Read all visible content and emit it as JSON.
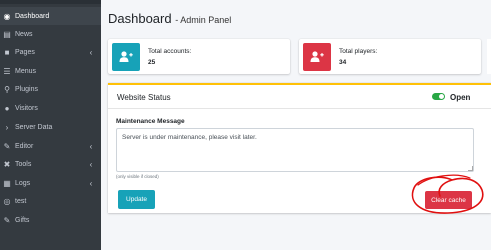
{
  "sidebar": {
    "items": [
      {
        "label": "Dashboard",
        "icon": "dashboard-icon",
        "glyph": "◉",
        "active": true,
        "has_children": false
      },
      {
        "label": "News",
        "icon": "newspaper-icon",
        "glyph": "▤",
        "active": false,
        "has_children": false
      },
      {
        "label": "Pages",
        "icon": "book-icon",
        "glyph": "■",
        "active": false,
        "has_children": true
      },
      {
        "label": "Menus",
        "icon": "menu-icon",
        "glyph": "☰",
        "active": false,
        "has_children": false
      },
      {
        "label": "Plugins",
        "icon": "plug-icon",
        "glyph": "⚲",
        "active": false,
        "has_children": false
      },
      {
        "label": "Visitors",
        "icon": "user-icon",
        "glyph": "●",
        "active": false,
        "has_children": false
      },
      {
        "label": "Server Data",
        "icon": "chevron-right-icon",
        "glyph": "›",
        "active": false,
        "has_children": false
      },
      {
        "label": "Editor",
        "icon": "edit-icon",
        "glyph": "✎",
        "active": false,
        "has_children": true
      },
      {
        "label": "Tools",
        "icon": "tools-icon",
        "glyph": "✖",
        "active": false,
        "has_children": true
      },
      {
        "label": "Logs",
        "icon": "logs-icon",
        "glyph": "▦",
        "active": false,
        "has_children": true
      },
      {
        "label": "test",
        "icon": "circle-icon",
        "glyph": "◎",
        "active": false,
        "has_children": false
      },
      {
        "label": "Gifts",
        "icon": "gift-icon",
        "glyph": "✎",
        "active": false,
        "has_children": false
      }
    ]
  },
  "header": {
    "title": "Dashboard",
    "subtitle": "- Admin Panel"
  },
  "stats": [
    {
      "label": "Total accounts:",
      "value": "25",
      "icon": "user-plus-icon",
      "color": "#17a2b8"
    },
    {
      "label": "Total players:",
      "value": "34",
      "icon": "user-plus-icon",
      "color": "#dc3545"
    }
  ],
  "website_status": {
    "title": "Website Status",
    "toggle_state": "Open",
    "toggle_on": true,
    "accent": "#ffc107",
    "maintenance_label": "Maintenance Message",
    "maintenance_message": "Server is under maintenance, please visit later.",
    "hint": "(only visible if closed)",
    "update_label": "Update",
    "clear_cache_label": "Clear cache"
  },
  "colors": {
    "sidebar_bg": "#343a40",
    "info": "#17a2b8",
    "danger": "#dc3545",
    "success": "#28a745",
    "annotation": "#e01010"
  }
}
